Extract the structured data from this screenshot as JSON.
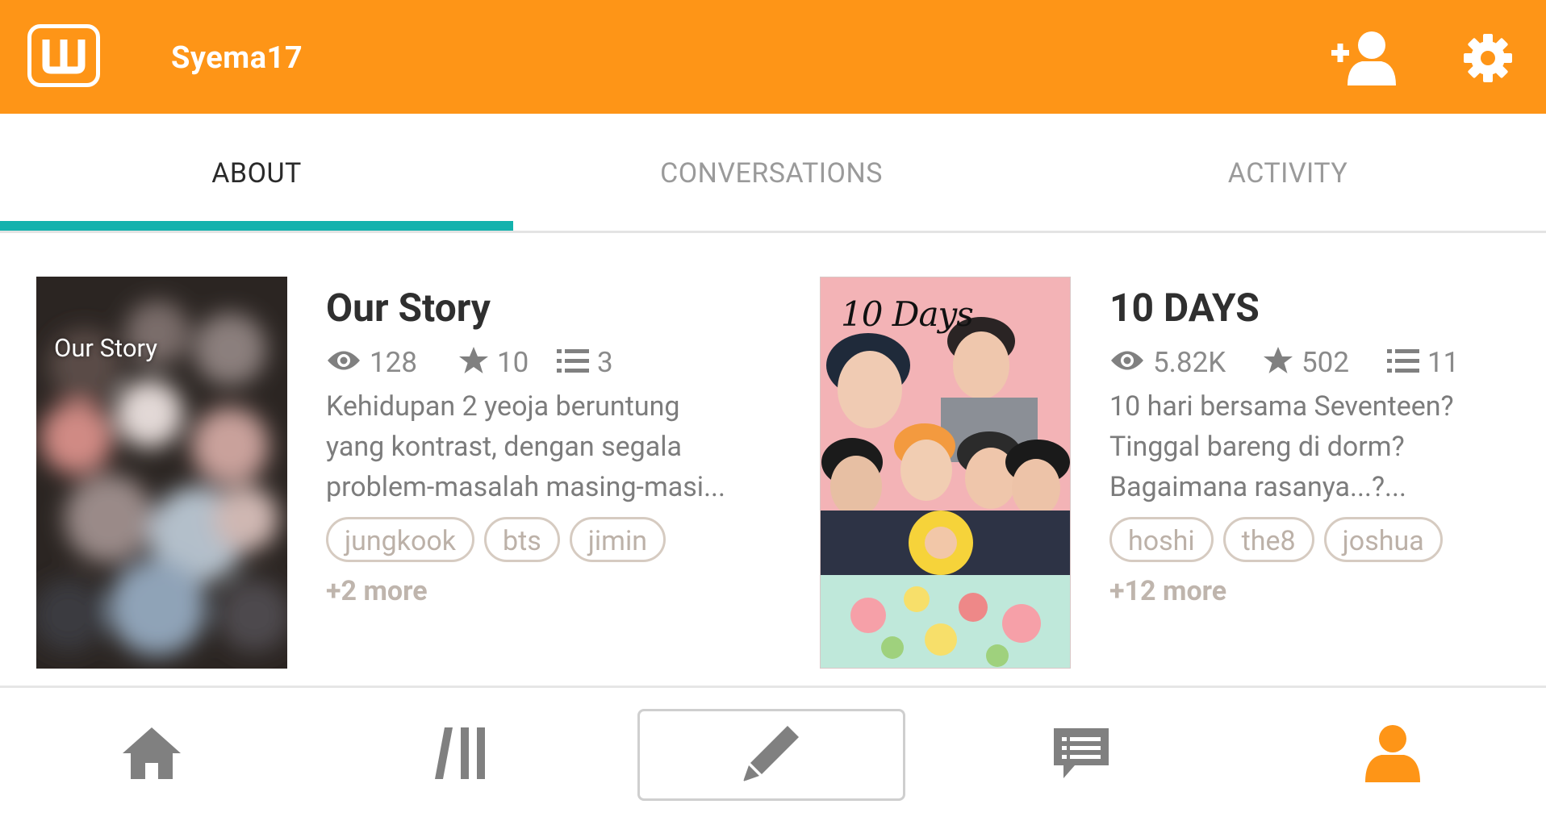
{
  "header": {
    "app_logo": "wattpad-logo-icon",
    "username": "Syema17",
    "actions": [
      "add-friend-icon",
      "gear-icon"
    ]
  },
  "tabs": [
    {
      "label": "ABOUT",
      "active": true
    },
    {
      "label": "CONVERSATIONS",
      "active": false
    },
    {
      "label": "ACTIVITY",
      "active": false
    }
  ],
  "stories": [
    {
      "cover_text": "Our Story",
      "title": "Our Story",
      "reads": "128",
      "votes": "10",
      "parts": "3",
      "description": [
        "Kehidupan 2 yeoja beruntung",
        "yang kontrast, dengan segala",
        "problem-masalah masing-masi..."
      ],
      "tags": [
        "jungkook",
        "bts",
        "jimin"
      ],
      "more": "+2 more"
    },
    {
      "cover_text": "10 Days",
      "title": "10 DAYS",
      "reads": "5.82K",
      "votes": "502",
      "parts": "11",
      "description": [
        "10 hari bersama Seventeen?",
        "Tinggal bareng di dorm?",
        "Bagaimana rasanya...?..."
      ],
      "tags": [
        "hoshi",
        "the8",
        "joshua"
      ],
      "more": "+12 more"
    }
  ],
  "bottom_nav": [
    "home-icon",
    "library-icon",
    "pencil-icon",
    "messages-icon",
    "profile-icon"
  ],
  "colors": {
    "header_bg": "#fe9517",
    "tab_indicator": "#13b2ad",
    "active_nav": "#fe9517",
    "inactive_icon": "#7f7f7f"
  }
}
